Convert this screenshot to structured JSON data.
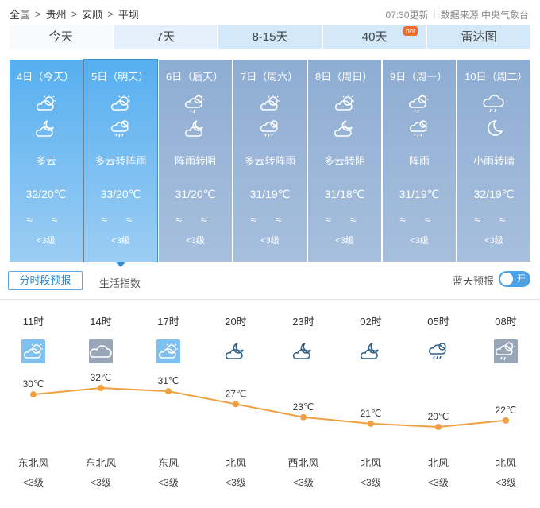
{
  "breadcrumb": {
    "items": [
      "全国",
      "贵州",
      "安顺",
      "平坝"
    ],
    "sep": ">"
  },
  "top_info": {
    "update": "07:30更新",
    "source": "数据来源 中央气象台"
  },
  "tabs": [
    {
      "label": "今天"
    },
    {
      "label": "7天"
    },
    {
      "label": "8-15天"
    },
    {
      "label": "40天",
      "badge": "hot"
    },
    {
      "label": "雷达图"
    }
  ],
  "days": [
    {
      "date": "4日（今天）",
      "icon_day": "partly-cloudy-day-icon",
      "icon_night": "cloudy-night-icon",
      "desc": "多云",
      "temp": "32/20℃",
      "wind": "≈ ≈",
      "level": "<3级"
    },
    {
      "date": "5日（明天）",
      "icon_day": "partly-cloudy-day-icon",
      "icon_night": "shower-icon",
      "desc": "多云转阵雨",
      "temp": "33/20℃",
      "wind": "≈ ≈",
      "level": "<3级"
    },
    {
      "date": "6日（后天）",
      "icon_day": "shower-day-icon",
      "icon_night": "cloudy-night-icon",
      "desc": "阵雨转阴",
      "temp": "31/20℃",
      "wind": "≈ ≈",
      "level": "<3级"
    },
    {
      "date": "7日（周六）",
      "icon_day": "partly-cloudy-day-icon",
      "icon_night": "shower-icon",
      "desc": "多云转阵雨",
      "temp": "31/19℃",
      "wind": "≈ ≈",
      "level": "<3级"
    },
    {
      "date": "8日（周日）",
      "icon_day": "partly-cloudy-day-icon",
      "icon_night": "cloudy-night-icon",
      "desc": "多云转阴",
      "temp": "31/18℃",
      "wind": "≈ ≈",
      "level": "<3级"
    },
    {
      "date": "9日（周一）",
      "icon_day": "shower-day-icon",
      "icon_night": "shower-icon",
      "desc": "阵雨",
      "temp": "31/19℃",
      "wind": "≈ ≈",
      "level": "<3级"
    },
    {
      "date": "10日（周二）",
      "icon_day": "rain-icon",
      "icon_night": "moon-icon",
      "desc": "小雨转晴",
      "temp": "32/19℃",
      "wind": "≈ ≈",
      "level": "<3级"
    }
  ],
  "subtabs": {
    "active": "分时段预报",
    "other": "生活指数"
  },
  "sky": {
    "label": "蓝天预报",
    "toggle": "开"
  },
  "hourly": [
    {
      "time": "11时",
      "icon": "partly-cloudy-day-icon",
      "temp": 30,
      "temp_label": "30℃",
      "wind": "东北风",
      "level": "<3级"
    },
    {
      "time": "14时",
      "icon": "overcast-icon",
      "temp": 32,
      "temp_label": "32℃",
      "wind": "东北风",
      "level": "<3级"
    },
    {
      "time": "17时",
      "icon": "partly-cloudy-day-icon",
      "temp": 31,
      "temp_label": "31℃",
      "wind": "东风",
      "level": "<3级"
    },
    {
      "time": "20时",
      "icon": "cloudy-night-icon",
      "temp": 27,
      "temp_label": "27℃",
      "wind": "北风",
      "level": "<3级"
    },
    {
      "time": "23时",
      "icon": "cloudy-night-icon",
      "temp": 23,
      "temp_label": "23℃",
      "wind": "西北风",
      "level": "<3级"
    },
    {
      "time": "02时",
      "icon": "cloudy-night-icon",
      "temp": 21,
      "temp_label": "21℃",
      "wind": "北风",
      "level": "<3级"
    },
    {
      "time": "05时",
      "icon": "shower-icon",
      "temp": 20,
      "temp_label": "20℃",
      "wind": "北风",
      "level": "<3级"
    },
    {
      "time": "08时",
      "icon": "shower-day-icon",
      "temp": 22,
      "temp_label": "22℃",
      "wind": "北风",
      "level": "<3级"
    }
  ],
  "chart_data": {
    "type": "line",
    "categories": [
      "11时",
      "14时",
      "17时",
      "20时",
      "23时",
      "02时",
      "05时",
      "08时"
    ],
    "values": [
      30,
      32,
      31,
      27,
      23,
      21,
      20,
      22
    ],
    "line_color": "#f0a040"
  }
}
